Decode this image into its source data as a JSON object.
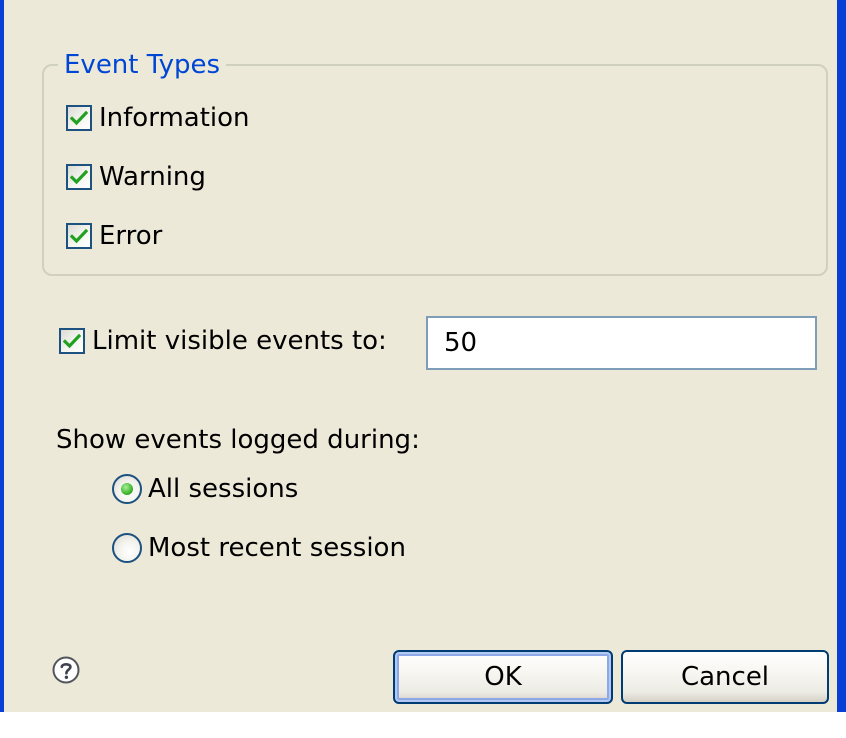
{
  "dialog": {
    "event_types": {
      "legend": "Event Types",
      "information": {
        "label": "Information",
        "checked": true
      },
      "warning": {
        "label": "Warning",
        "checked": true
      },
      "error": {
        "label": "Error",
        "checked": true
      }
    },
    "limit": {
      "label": "Limit visible events to:",
      "checked": true,
      "value": "50"
    },
    "sessions": {
      "label": "Show events logged during:",
      "all": {
        "label": "All sessions",
        "selected": true
      },
      "recent": {
        "label": "Most recent session",
        "selected": false
      }
    },
    "help_icon": "question-circle-icon",
    "buttons": {
      "ok": "OK",
      "cancel": "Cancel"
    }
  },
  "colors": {
    "window_background": "#ECE9D8",
    "window_frame": "#0A3FD6",
    "legend_text": "#0046D5",
    "check_mark": "#21A121",
    "radio_dot": "#3FB52E",
    "control_border": "#1C5180",
    "field_border": "#7F9DB9",
    "button_border": "#003C74"
  }
}
